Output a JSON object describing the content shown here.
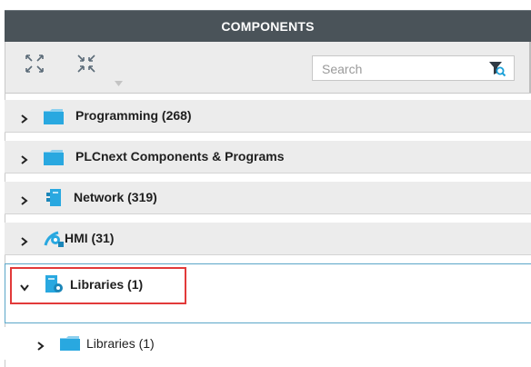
{
  "panel": {
    "title": "COMPONENTS"
  },
  "toolbar": {
    "expand_all_icon": "expand-all-icon",
    "collapse_all_icon": "collapse-all-icon",
    "search_placeholder": "Search",
    "filter_icon": "filter-icon"
  },
  "categories": [
    {
      "label": "Programming (268)",
      "icon": "folder-icon",
      "expanded": false
    },
    {
      "label": "PLCnext Components & Programs",
      "icon": "folder-icon",
      "expanded": false
    },
    {
      "label": "Network (319)",
      "icon": "network-device-icon",
      "expanded": false
    },
    {
      "label": "HMI (31)",
      "icon": "hmi-icon",
      "expanded": false
    },
    {
      "label": "Libraries (1)",
      "icon": "library-icon",
      "expanded": true
    }
  ],
  "library_children": [
    {
      "label": "Libraries (1)",
      "icon": "folder-icon",
      "expanded": false
    }
  ],
  "colors": {
    "header_bg": "#4a5359",
    "row_bg": "#ececec",
    "selection_border": "#5aa6c8",
    "highlight_border": "#e23a3a",
    "folder_blue": "#29a8e0"
  }
}
